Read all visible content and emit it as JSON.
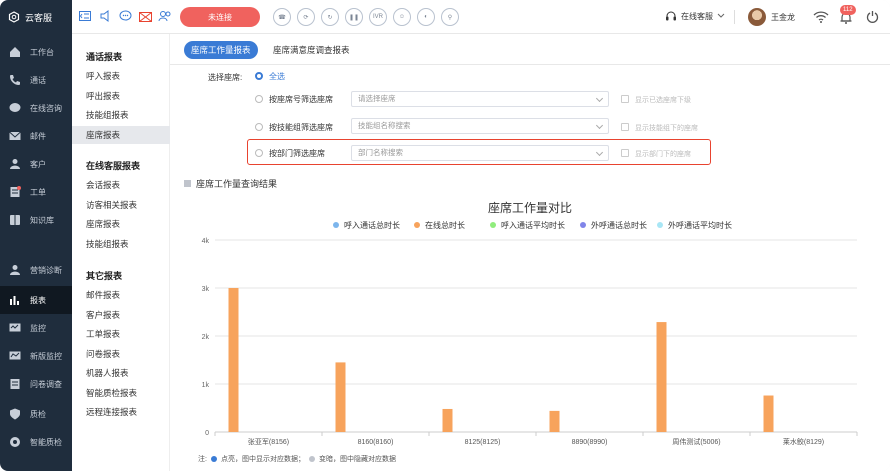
{
  "app": {
    "name": "云客服"
  },
  "topbar": {
    "connect_label": "未连接",
    "call_icons": [
      "hangup-icon",
      "hold-icon",
      "transfer-icon",
      "pause-icon",
      "ivr-icon",
      "mute-icon",
      "consult-icon",
      "three-way-icon"
    ],
    "ivr_label": "IVR",
    "status_label": "在线客服",
    "user_name": "王金龙",
    "notification_count": "112"
  },
  "sidebar": {
    "items": [
      {
        "label": "工作台",
        "icon": "home-icon"
      },
      {
        "label": "通话",
        "icon": "phone-icon"
      },
      {
        "label": "在线咨询",
        "icon": "chat-icon"
      },
      {
        "label": "邮件",
        "icon": "mail-icon"
      },
      {
        "label": "客户",
        "icon": "user-icon"
      },
      {
        "label": "工单",
        "icon": "ticket-icon"
      },
      {
        "label": "知识库",
        "icon": "book-icon"
      },
      {
        "label": "营销诊断",
        "icon": "marketing-icon"
      },
      {
        "label": "报表",
        "icon": "report-icon"
      },
      {
        "label": "监控",
        "icon": "monitor-icon"
      },
      {
        "label": "新版监控",
        "icon": "new-monitor-icon"
      },
      {
        "label": "问卷调查",
        "icon": "survey-icon"
      },
      {
        "label": "质检",
        "icon": "quality-icon"
      },
      {
        "label": "智能质检",
        "icon": "smart-quality-icon"
      }
    ]
  },
  "submenu": {
    "groups": [
      {
        "title": "通话报表",
        "items": [
          "呼入报表",
          "呼出报表",
          "技能组报表",
          "座席报表"
        ]
      },
      {
        "title": "在线客服报表",
        "items": [
          "会话报表",
          "访客相关报表",
          "座席报表",
          "技能组报表"
        ]
      },
      {
        "title": "其它报表",
        "items": [
          "邮件报表",
          "客户报表",
          "工单报表",
          "问卷报表",
          "机器人报表",
          "智能质检报表",
          "远程连接报表"
        ]
      }
    ]
  },
  "tabs": [
    "座席工作量报表",
    "座席满意度调查报表"
  ],
  "filter": {
    "label": "选择座席:",
    "all_label": "全选",
    "rows": [
      {
        "label": "按座席号筛选座席",
        "placeholder": "请选择座席",
        "check_label": "显示已选座席下级"
      },
      {
        "label": "按技能组筛选座席",
        "placeholder": "技能组名称搜索",
        "check_label": "显示技能组下的座席"
      },
      {
        "label": "按部门筛选座席",
        "placeholder": "部门名称搜索",
        "check_label": "显示部门下的座席"
      }
    ]
  },
  "result_title": "座席工作量查询结果",
  "chart_data": {
    "type": "bar",
    "title": "座席工作量对比",
    "categories": [
      "张亚军(8156)",
      "8160(8160)",
      "8125(8125)",
      "8890(8990)",
      "周伟测试(5006)",
      "莱水鲛(8129)"
    ],
    "series": [
      {
        "name": "呼入通话总时长",
        "color": "#7cb5ec",
        "values": [
          0,
          0,
          0,
          0,
          0,
          0
        ]
      },
      {
        "name": "在线总时长",
        "color": "#f7a35c",
        "values": [
          3000,
          1450,
          480,
          440,
          2290,
          760
        ]
      },
      {
        "name": "呼入通话平均时长",
        "color": "#90ed7d",
        "values": [
          0,
          0,
          0,
          0,
          0,
          0
        ]
      },
      {
        "name": "外呼通话总时长",
        "color": "#8085e9",
        "values": [
          0,
          0,
          0,
          0,
          0,
          0
        ]
      },
      {
        "name": "外呼通话平均时长",
        "color": "#a8e6f5",
        "values": [
          0,
          0,
          0,
          0,
          0,
          0
        ]
      }
    ],
    "y_ticks": [
      "0",
      "1k",
      "2k",
      "3k",
      "4k"
    ],
    "ylim": [
      0,
      4000
    ],
    "grid": true,
    "legend": "top"
  },
  "footer": {
    "prefix": "注:",
    "note1": "点亮，图中显示对应数据；",
    "note2": "变暗，图中隐藏对应数据",
    "dot1_color": "#3a7bd5",
    "dot2_color": "#c0c4cc"
  }
}
